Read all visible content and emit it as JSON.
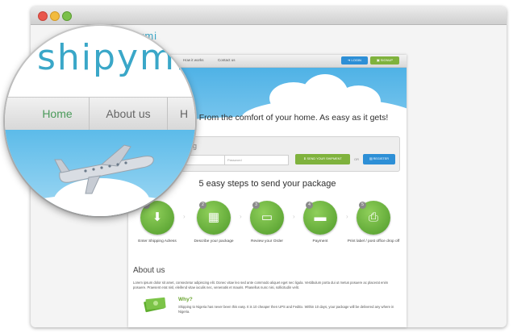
{
  "brand": {
    "logo_text": "shipymi",
    "colors": {
      "accent_blue": "#2d8fd6",
      "accent_green": "#7fb23d",
      "sky": "#4fb2e6",
      "logo": "#3aa7c8"
    }
  },
  "nav": {
    "items": [
      "Home",
      "About us",
      "How it works",
      "Contact us"
    ],
    "login_label": "LOGIN",
    "signup_label": "SIGNUP"
  },
  "hero": {
    "title": "Ship by Air - From the comfort of your home. As easy as it gets!",
    "visible_title": "y Air - From the comfort of your home. As easy as it gets!"
  },
  "tracking": {
    "label": "ing",
    "email_placeholder": "",
    "password_placeholder": "Password",
    "send_label": "SEND YOUR SHIPMENT",
    "or_text": "OR",
    "register_label": "REGISTER"
  },
  "steps": {
    "title": "5 easy steps to send your package",
    "items": [
      {
        "num": "1",
        "label": "Enter Shipping Adress",
        "icon": "download-box-icon"
      },
      {
        "num": "2",
        "label": "Describe your package",
        "icon": "package-cart-icon"
      },
      {
        "num": "3",
        "label": "Review your Order",
        "icon": "monitor-icon"
      },
      {
        "num": "4",
        "label": "Payment",
        "icon": "credit-card-icon"
      },
      {
        "num": "5",
        "label": "Print label / post office drop off",
        "icon": "printer-icon"
      }
    ]
  },
  "about": {
    "title": "About us",
    "text": "Lorem ipsum dolor sit amet, consectetur adipiscing elit. Donec vitae leo sed ante commodo aliquet eget nec ligula. Vestibulum porta dui ut metus posuere ac placerat enim posuere. Praesent erat nisl, eleifend vitae iaculis nec, venenatis et mauris. Phasellus nunc nisi, sollicitudin velit.",
    "why_title": "Why?",
    "why_text": "Shipping to Nigeria has never been this easy. It is 10 cheaper then UPS and FedEx. Within 10 days, your package will be delivered any where in Nigeria."
  },
  "magnifier": {
    "tabs": [
      "Home",
      "About us",
      "H"
    ]
  }
}
